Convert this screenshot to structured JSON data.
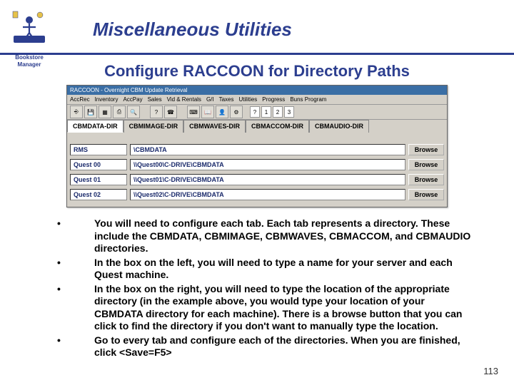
{
  "logo": {
    "line1": "Bookstore",
    "line2": "Manager"
  },
  "title": "Miscellaneous Utilities",
  "subtitle": "Configure RACCOON for Directory Paths",
  "app": {
    "window_title": "RACCOON - Overnight CBM Update Retrieval",
    "menu": [
      "AccRec",
      "Inventory",
      "AccPay",
      "Sales",
      "Vid & Rentals",
      "G/I",
      "Taxes",
      "Utilities",
      "Progress",
      "Buns Program"
    ],
    "toolnums": [
      "?",
      "1",
      "2",
      "3"
    ],
    "tabs": [
      "CBMDATA-DIR",
      "CBMIMAGE-DIR",
      "CBMWAVES-DIR",
      "CBMACCOM-DIR",
      "CBMAUDIO-DIR"
    ],
    "rows": [
      {
        "name": "RMS",
        "path": "\\CBMDATA"
      },
      {
        "name": "Quest 00",
        "path": "\\\\Quest00\\C-DRIVE\\CBMDATA"
      },
      {
        "name": "Quest 01",
        "path": "\\\\Quest01\\C-DRIVE\\CBMDATA"
      },
      {
        "name": "Quest 02",
        "path": "\\\\Quest02\\C-DRIVE\\CBMDATA"
      }
    ],
    "browse_label": "Browse"
  },
  "bullets": [
    "You will need to configure each tab.  Each tab represents a directory.  These include the CBMDATA, CBMIMAGE, CBMWAVES, CBMACCOM, and CBMAUDIO directories.",
    "In the box on the left, you will need to type a name for your server and each Quest machine.",
    "In the box on the right, you will need to type the location of the appropriate directory (in the example above, you would type your location of your CBMDATA directory for each machine).  There is a browse button that you can click to find the directory if you don't want to manually type the location.",
    "Go to every tab and configure each of the directories.  When you are finished, click <Save=F5>"
  ],
  "page_number": "113"
}
